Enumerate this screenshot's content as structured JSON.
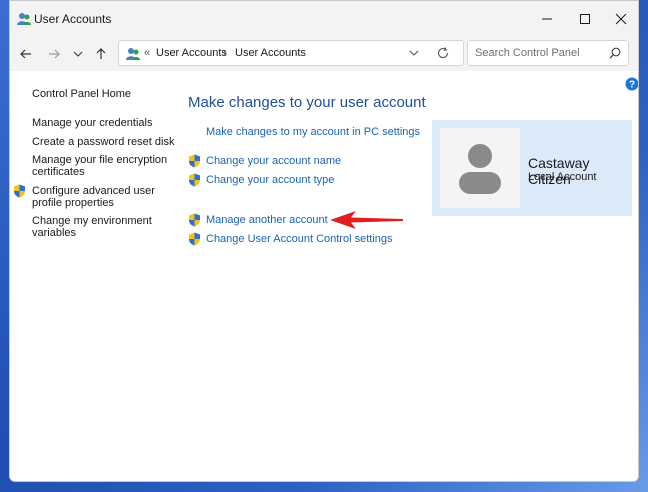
{
  "window": {
    "title": "User Accounts"
  },
  "navigation": {
    "breadcrumb_overflow": "«",
    "breadcrumb": [
      "User Accounts",
      "User Accounts"
    ],
    "search_placeholder": "Search Control Panel"
  },
  "sidebar": {
    "home": "Control Panel Home",
    "items": [
      {
        "label": "Manage your credentials"
      },
      {
        "label": "Create a password reset disk"
      },
      {
        "label_lines": [
          "Manage your file encryption",
          "certificates"
        ]
      },
      {
        "label_lines": [
          "Configure advanced user",
          "profile properties"
        ],
        "icon": "shield-icon"
      },
      {
        "label_lines": [
          "Change my environment",
          "variables"
        ]
      }
    ]
  },
  "main": {
    "heading": "Make changes to your user account",
    "links": [
      {
        "label": "Make changes to my account in PC settings"
      },
      {
        "label": "Change your account name",
        "icon": "shield-icon"
      },
      {
        "label": "Change your account type",
        "icon": "shield-icon"
      },
      {
        "label": "Manage another account",
        "icon": "shield-icon"
      },
      {
        "label": "Change User Account Control settings",
        "icon": "shield-icon"
      }
    ]
  },
  "account": {
    "name": "Castaway Citizen",
    "type": "Local Account"
  },
  "colors": {
    "link": "#1d63b5",
    "heading": "#1f4e9c",
    "card_background": "#dce9f8",
    "arrow": "#e02020"
  }
}
